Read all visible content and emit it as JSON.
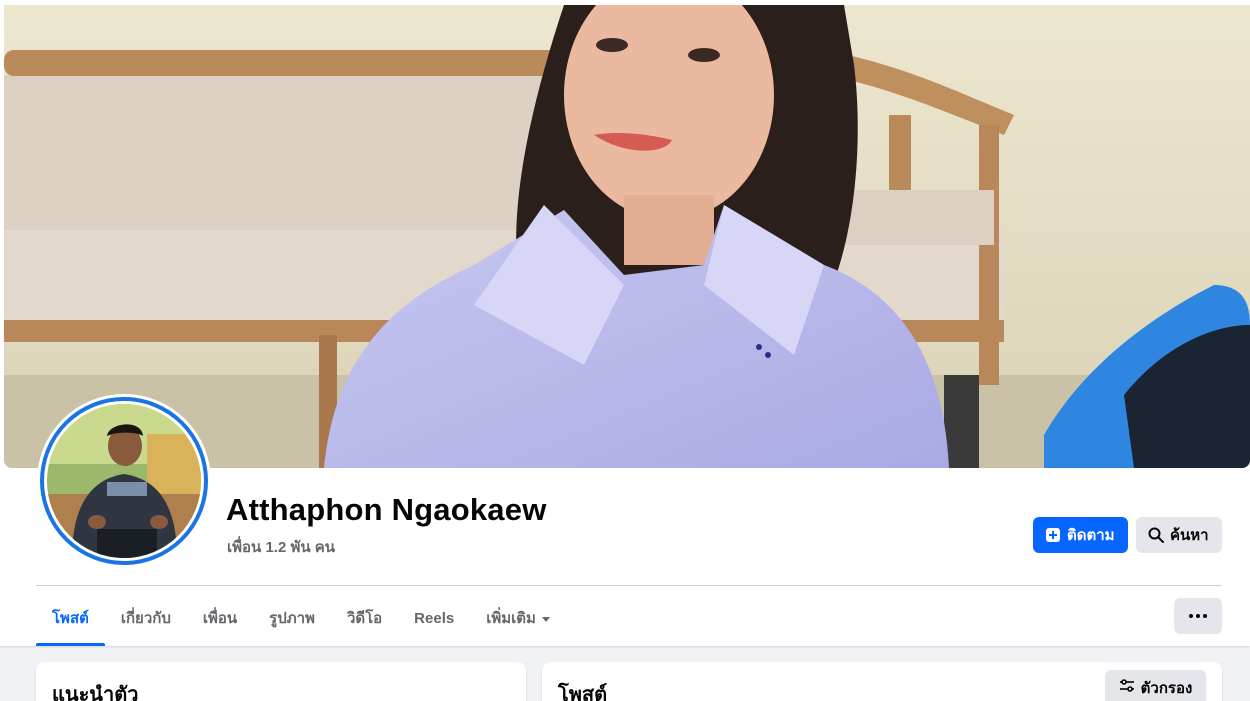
{
  "profile": {
    "name": "Atthaphon Ngaokaew",
    "friends_text": "เพื่อน 1.2 พัน คน"
  },
  "actions": {
    "follow_label": "ติดตาม",
    "search_label": "ค้นหา"
  },
  "tabs": [
    {
      "label": "โพสต์",
      "active": true
    },
    {
      "label": "เกี่ยวกับ",
      "active": false
    },
    {
      "label": "เพื่อน",
      "active": false
    },
    {
      "label": "รูปภาพ",
      "active": false
    },
    {
      "label": "วิดีโอ",
      "active": false
    },
    {
      "label": "Reels",
      "active": false
    },
    {
      "label": "เพิ่มเติม",
      "active": false
    }
  ],
  "intro_card": {
    "title": "แนะนำตัว"
  },
  "posts_card": {
    "title": "โพสต์",
    "filter_label": "ตัวกรอง"
  },
  "colors": {
    "accent": "#0866ff",
    "secondary_button": "#e4e6eb",
    "page_bg": "#f0f2f5",
    "muted_text": "#65676b",
    "avatar_ring": "#1b74e4"
  },
  "icons": {
    "follow": "plus-person-icon",
    "search": "search-icon",
    "more": "more-dots-icon",
    "filter": "filter-icon",
    "tab_caret": "caret-down-icon"
  }
}
